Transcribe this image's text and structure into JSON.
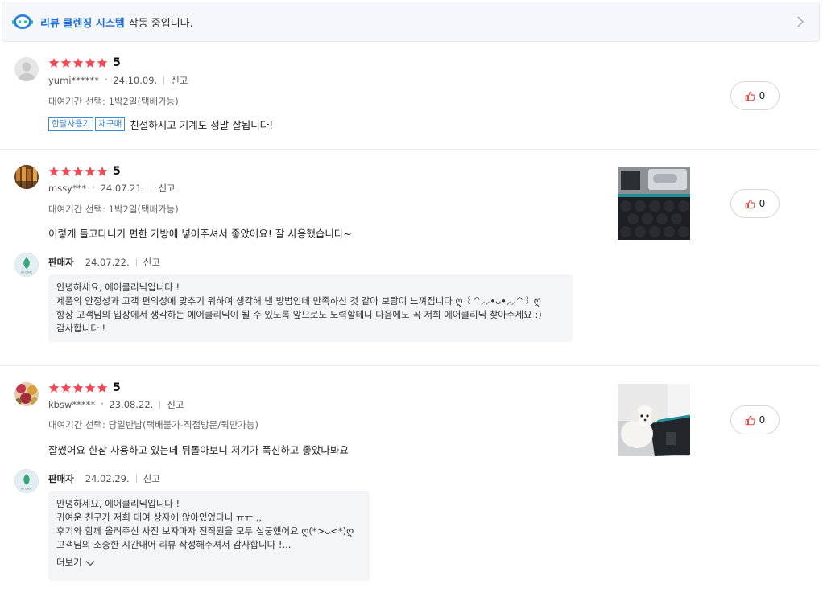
{
  "banner": {
    "strong": "리뷰 클렌징 시스템",
    "text": "작동 중입니다."
  },
  "colors": {
    "star": "#ef4a57",
    "brand_blue": "#1e6fdc",
    "tag_blue": "#3c8bd8",
    "like_icon": "#e34242"
  },
  "reviews": [
    {
      "score": "5",
      "user": "yumi******",
      "date": "24.10.09.",
      "report": "신고",
      "option": "대여기간 선택: 1박2일(택배가능)",
      "tags": [
        "한달사용기",
        "재구매"
      ],
      "text": "친절하시고 기계도 정말 잘됩니다!",
      "likes": "0"
    },
    {
      "score": "5",
      "user": "mssy***",
      "date": "24.07.21.",
      "report": "신고",
      "option": "대여기간 선택: 1박2일(택배가능)",
      "text": "이렇게 들고다니기 편한 가방에 넣어주셔서 좋았어요! 잘 사용했습니다~",
      "likes": "0",
      "reply": {
        "seller": "판매자",
        "date": "24.07.22.",
        "report": "신고",
        "lines": [
          "안녕하세요, 에어클리닉입니다 !",
          "제품의 안정성과 고객 편의성에 맞추기 위하여 생각해 낸 방법인데 만족하신 것 같아 보람이 느껴집니다 ღ ꒰^⸝⸝•ᴗ•⸝⸝^꒱ ღ",
          "항상 고객님의 입장에서 생각하는 에어클리닉이 될 수 있도록 앞으로도 노력할테니 다음에도 꼭 저희 에어클리닉 찾아주세요 :)",
          "감사합니다 !"
        ]
      }
    },
    {
      "score": "5",
      "user": "kbsw*****",
      "date": "23.08.22.",
      "report": "신고",
      "option": "대여기간 선택: 당일반납(택배불가-직접방문/퀵만가능)",
      "text": "잘썼어요 한참 사용하고 있는데 뒤돌아보니 저기가 푹신하고 좋았나봐요",
      "likes": "0",
      "reply": {
        "seller": "판매자",
        "date": "24.02.29.",
        "report": "신고",
        "lines": [
          "안녕하세요, 에어클리닉입니다 !",
          "귀여운 친구가 저희 대여 상자에 앉아있었다니 ㅠㅠ ,,",
          "후기와 함께 올려주신 사진 보자마자 전직원을 모두 심쿵했어요 ღ(*>ᴗ<*)ღ",
          "고객님의 소중한 시간내어 리뷰 작성해주셔서 감사합니다 !..."
        ],
        "more": "더보기"
      }
    }
  ]
}
